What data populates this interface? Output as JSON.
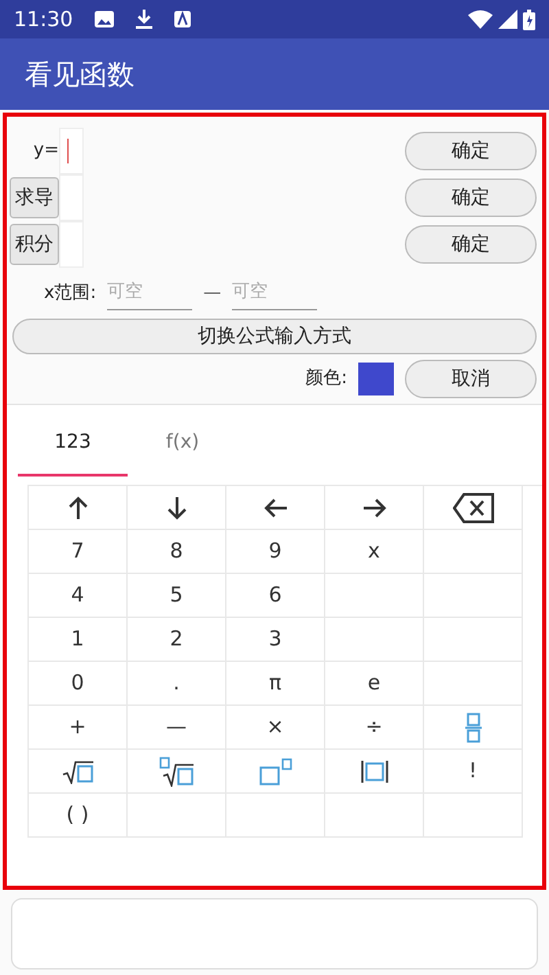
{
  "status_bar": {
    "time": "11:30"
  },
  "app_bar": {
    "title": "看见函数"
  },
  "form": {
    "rows": [
      {
        "kind": "label",
        "label": "y=",
        "focused": true,
        "button": "确定"
      },
      {
        "kind": "button",
        "label": "求导",
        "focused": false,
        "button": "确定"
      },
      {
        "kind": "button",
        "label": "积分",
        "focused": false,
        "button": "确定"
      }
    ],
    "range": {
      "label": "x范围:",
      "from_placeholder": "可空",
      "separator": "—",
      "to_placeholder": "可空"
    },
    "switch_button": "切换公式输入方式",
    "color_label": "颜色:",
    "color": "#3f48cc",
    "cancel_button": "取消"
  },
  "keyboard": {
    "tabs": [
      {
        "label": "123",
        "selected": true
      },
      {
        "label": "f(x)",
        "selected": false
      }
    ],
    "keys": [
      [
        {
          "kind": "up"
        },
        {
          "kind": "down"
        },
        {
          "kind": "left"
        },
        {
          "kind": "right"
        },
        {
          "kind": "backspace"
        }
      ],
      [
        {
          "kind": "text",
          "label": "7"
        },
        {
          "kind": "text",
          "label": "8"
        },
        {
          "kind": "text",
          "label": "9"
        },
        {
          "kind": "text",
          "label": "x"
        },
        {
          "kind": "empty"
        }
      ],
      [
        {
          "kind": "text",
          "label": "4"
        },
        {
          "kind": "text",
          "label": "5"
        },
        {
          "kind": "text",
          "label": "6"
        },
        {
          "kind": "empty"
        },
        {
          "kind": "empty"
        }
      ],
      [
        {
          "kind": "text",
          "label": "1"
        },
        {
          "kind": "text",
          "label": "2"
        },
        {
          "kind": "text",
          "label": "3"
        },
        {
          "kind": "empty"
        },
        {
          "kind": "empty"
        }
      ],
      [
        {
          "kind": "text",
          "label": "0"
        },
        {
          "kind": "text",
          "label": "."
        },
        {
          "kind": "text",
          "label": "π"
        },
        {
          "kind": "text",
          "label": "e"
        },
        {
          "kind": "empty"
        }
      ],
      [
        {
          "kind": "text",
          "label": "+"
        },
        {
          "kind": "text",
          "label": "—"
        },
        {
          "kind": "text",
          "label": "×"
        },
        {
          "kind": "text",
          "label": "÷"
        },
        {
          "kind": "fraction"
        }
      ],
      [
        {
          "kind": "sqrt"
        },
        {
          "kind": "nthroot"
        },
        {
          "kind": "power"
        },
        {
          "kind": "abs"
        },
        {
          "kind": "text",
          "label": "!"
        }
      ],
      [
        {
          "kind": "text",
          "label": "( )"
        },
        {
          "kind": "empty"
        },
        {
          "kind": "empty"
        },
        {
          "kind": "empty"
        },
        {
          "kind": "empty"
        }
      ]
    ]
  }
}
